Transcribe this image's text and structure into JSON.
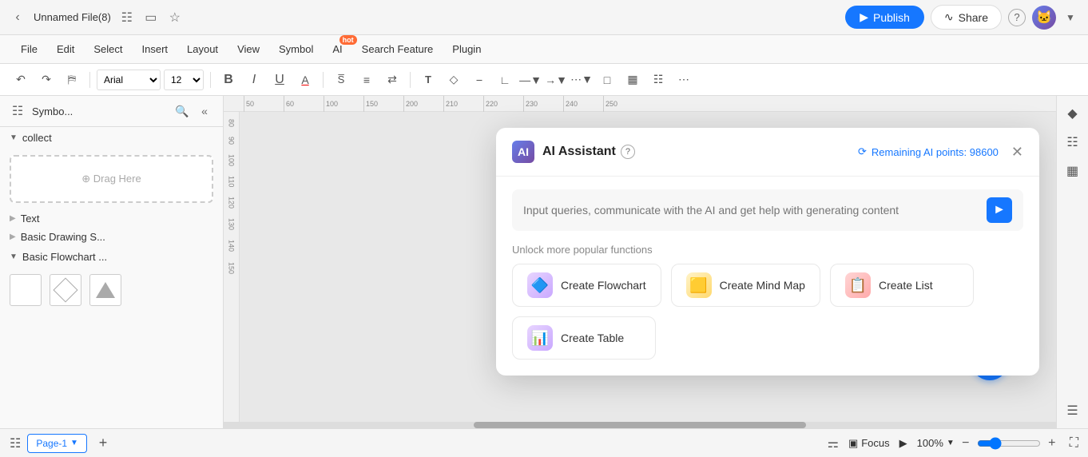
{
  "titleBar": {
    "title": "Unnamed File(8)",
    "publishLabel": "Publish",
    "shareLabel": "Share"
  },
  "menuBar": {
    "items": [
      {
        "label": "File"
      },
      {
        "label": "Edit"
      },
      {
        "label": "Select"
      },
      {
        "label": "Insert"
      },
      {
        "label": "Layout"
      },
      {
        "label": "View"
      },
      {
        "label": "Symbol"
      },
      {
        "label": "AI"
      },
      {
        "label": "Search Feature"
      },
      {
        "label": "Plugin"
      }
    ],
    "aiHotBadge": "hot"
  },
  "toolbar": {
    "fontFamily": "Arial",
    "fontSize": "12",
    "boldLabel": "B",
    "italicLabel": "I",
    "underlineLabel": "U"
  },
  "sidebar": {
    "title": "Symbo...",
    "searchPlaceholder": "Search",
    "dragHereLabel": "⊕  Drag Here",
    "sections": [
      {
        "label": "collect",
        "expanded": true
      },
      {
        "label": "Text",
        "expanded": false
      },
      {
        "label": "Basic Drawing S...",
        "expanded": false
      },
      {
        "label": "Basic Flowchart ...",
        "expanded": true
      }
    ]
  },
  "aiDialog": {
    "title": "AI Assistant",
    "pointsLabel": "Remaining AI points: 98600",
    "inputPlaceholder": "Input queries, communicate with the AI and get help with generating content",
    "functionsLabel": "Unlock more popular functions",
    "functions": [
      {
        "label": "Create Flowchart",
        "icon": "flowchart"
      },
      {
        "label": "Create Mind Map",
        "icon": "mindmap"
      },
      {
        "label": "Create List",
        "icon": "list"
      },
      {
        "label": "Create Table",
        "icon": "table"
      }
    ]
  },
  "bottomBar": {
    "pageLabel": "Page-1",
    "focusLabel": "Focus",
    "zoomLevel": "100%"
  },
  "rulers": {
    "marks": [
      "50",
      "60",
      "100",
      "150",
      "200",
      "210",
      "220",
      "230",
      "240",
      "250"
    ]
  }
}
